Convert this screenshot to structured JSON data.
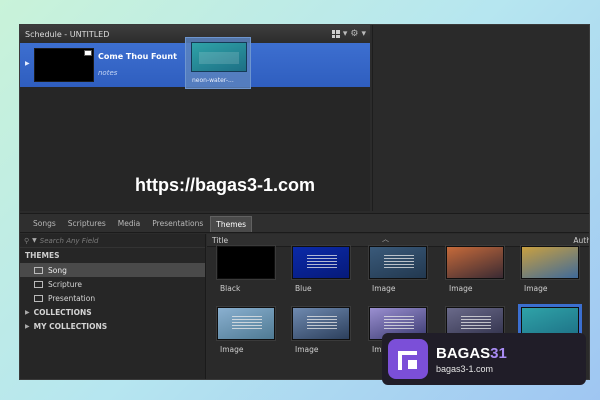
{
  "schedule": {
    "title": "Schedule - UNTITLED",
    "gear_glyph": "⚙",
    "caret_glyph": "▾",
    "item": {
      "title": "Come Thou Fount",
      "notes": "notes"
    },
    "drag_label": "neon-water-..."
  },
  "overlay_url": "https://bagas3-1.com",
  "tabs": [
    "Songs",
    "Scriptures",
    "Media",
    "Presentations",
    "Themes"
  ],
  "active_tab": "Themes",
  "sidebar": {
    "search_placeholder": "Search Any Field",
    "themes_header": "THEMES",
    "items": [
      "Song",
      "Scripture",
      "Presentation"
    ],
    "selected": "Song",
    "groups": [
      "COLLECTIONS",
      "MY COLLECTIONS"
    ]
  },
  "grid": {
    "col_title": "Title",
    "col_author": "Auth",
    "themes": [
      {
        "label": "Black",
        "colors": [
          "#000000",
          "#000000"
        ],
        "lines": false
      },
      {
        "label": "Blue",
        "colors": [
          "#0b2aa8",
          "#061a7a"
        ],
        "lines": true
      },
      {
        "label": "Image",
        "colors": [
          "#3a5a7a",
          "#22384f"
        ],
        "lines": true
      },
      {
        "label": "Image",
        "colors": [
          "#c66a3a",
          "#3a2a33"
        ],
        "lines": false
      },
      {
        "label": "Image",
        "colors": [
          "#c9a040",
          "#3f6a9a"
        ],
        "lines": false
      },
      {
        "label": "Image",
        "colors": [
          "#8ab0d0",
          "#4f7a93"
        ],
        "lines": true
      },
      {
        "label": "Image",
        "colors": [
          "#6f8ab0",
          "#2c3f5c"
        ],
        "lines": true
      },
      {
        "label": "Image",
        "colors": [
          "#9a8fd0",
          "#3a3a70"
        ],
        "lines": true
      },
      {
        "label": "Image",
        "colors": [
          "#6a6a8a",
          "#30304a"
        ],
        "lines": true
      },
      {
        "label": "Image",
        "colors": [
          "#2fa3a8",
          "#1d6f85"
        ],
        "lines": false
      }
    ]
  },
  "badge": {
    "brand_left": "BAGAS",
    "brand_right": "31",
    "domain": "bagas3-1.com"
  }
}
